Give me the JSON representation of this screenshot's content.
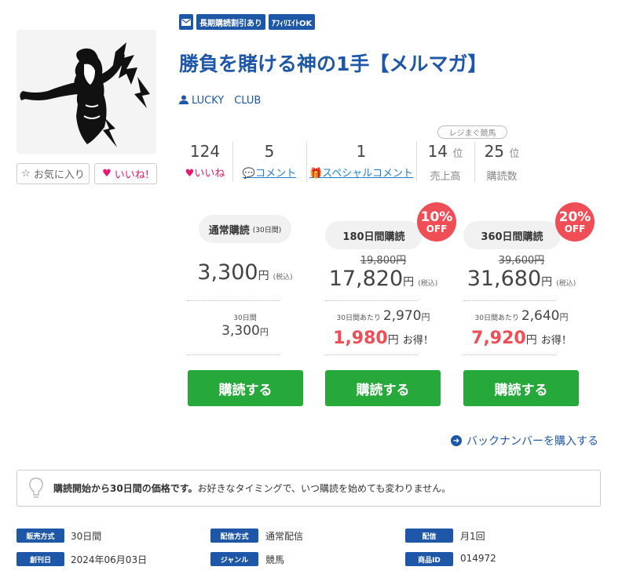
{
  "badges": {
    "mail_icon": "mail-icon",
    "long_term": "長期購読割引あり",
    "affiliate": "ｱﾌｨﾘｴｲﾄOK"
  },
  "title": "勝負を賭ける神の1手【メルマガ】",
  "author": "LUCKY　CLUB",
  "buttons": {
    "favorite": "お気に入り",
    "like": "いいね!"
  },
  "stats": {
    "likes": {
      "value": "124",
      "label": "いいね"
    },
    "comments": {
      "value": "5",
      "label": "コメント"
    },
    "special": {
      "value": "1",
      "label": "スペシャルコメント"
    },
    "rank_pill": "レジまぐ競馬",
    "sales_rank": {
      "value": "14",
      "unit": "位",
      "label": "売上高"
    },
    "subs_rank": {
      "value": "25",
      "unit": "位",
      "label": "購読数"
    }
  },
  "plans": [
    {
      "name": "通常購読",
      "period": "(30日間)",
      "price": "3,300",
      "yen": "円",
      "tax": "(税込)",
      "per_label": "30日間",
      "per_value": "3,300",
      "per_yen": "円",
      "button": "購読する"
    },
    {
      "name": "180日間購読",
      "discount": "10%",
      "off": "OFF",
      "original": "19,800円",
      "price": "17,820",
      "yen": "円",
      "tax": "(税込)",
      "per_label": "30日間あたり",
      "per_value": "2,970",
      "per_yen": "円",
      "save_value": "1,980",
      "save_yen": "円",
      "save_text": "お得！",
      "button": "購読する"
    },
    {
      "name": "360日間購読",
      "discount": "20%",
      "off": "OFF",
      "original": "39,600円",
      "price": "31,680",
      "yen": "円",
      "tax": "(税込)",
      "per_label": "30日間あたり",
      "per_value": "2,640",
      "per_yen": "円",
      "save_value": "7,920",
      "save_yen": "円",
      "save_text": "お得！",
      "button": "購読する"
    }
  ],
  "back_numbers": "バックナンバーを購入する",
  "notice": {
    "bold": "購読開始から30日間の価格です。",
    "text": "お好きなタイミングで、いつ購読を始めても変わりません。"
  },
  "meta": {
    "sale_type": {
      "label": "販売方式",
      "value": "30日間"
    },
    "delivery_type": {
      "label": "配信方式",
      "value": "通常配信"
    },
    "frequency": {
      "label": "配信",
      "value": "月1回"
    },
    "launch": {
      "label": "創刊日",
      "value": "2024年06月03日"
    },
    "genre": {
      "label": "ジャンル",
      "value": "競馬"
    },
    "product_id": {
      "label": "商品ID",
      "value": "014972"
    }
  },
  "colors": {
    "brand": "#1e57a8",
    "buy": "#27a83a",
    "discount": "#f04e56",
    "like": "#e8196d",
    "link": "#1e7fd2"
  }
}
